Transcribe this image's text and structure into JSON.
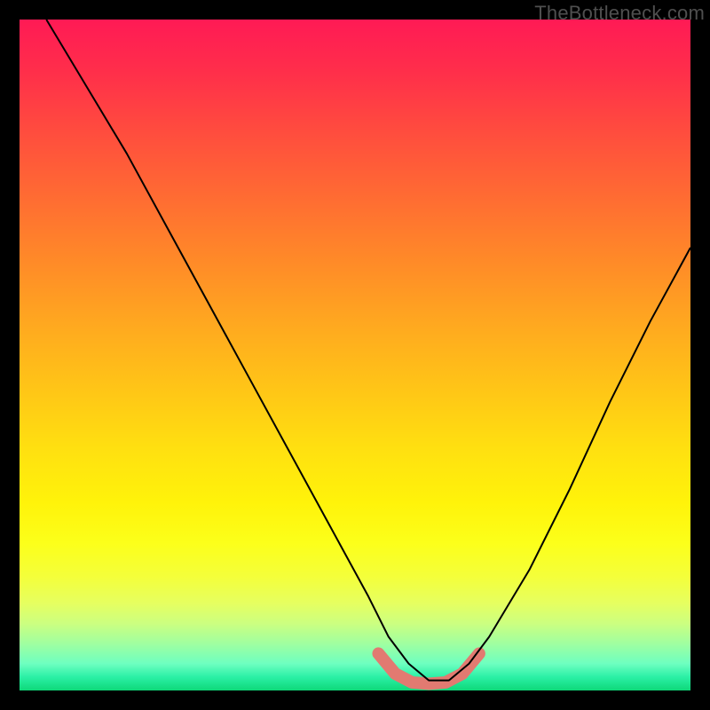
{
  "watermark": "TheBottleneck.com",
  "chart_data": {
    "type": "line",
    "title": "",
    "xlabel": "",
    "ylabel": "",
    "xlim": [
      0,
      100
    ],
    "ylim": [
      0,
      100
    ],
    "grid": false,
    "legend": false,
    "series": [
      {
        "name": "black-curve",
        "color": "#000000",
        "width": 2,
        "x": [
          4,
          10,
          16,
          22,
          28,
          34,
          40,
          46,
          52,
          55,
          58,
          61,
          64,
          67,
          70,
          76,
          82,
          88,
          94,
          100
        ],
        "values": [
          100,
          90,
          80,
          69,
          58,
          47,
          36,
          25,
          14,
          8,
          4,
          1.5,
          1.5,
          4,
          8,
          18,
          30,
          43,
          55,
          66
        ]
      },
      {
        "name": "salmon-highlight",
        "color": "#e27a71",
        "width": 10,
        "linecap": "round",
        "x": [
          53.5,
          56,
          58.5,
          61,
          63.5,
          66,
          68.5
        ],
        "values": [
          5.5,
          2.5,
          1.2,
          1.0,
          1.2,
          2.5,
          5.5
        ]
      }
    ]
  }
}
